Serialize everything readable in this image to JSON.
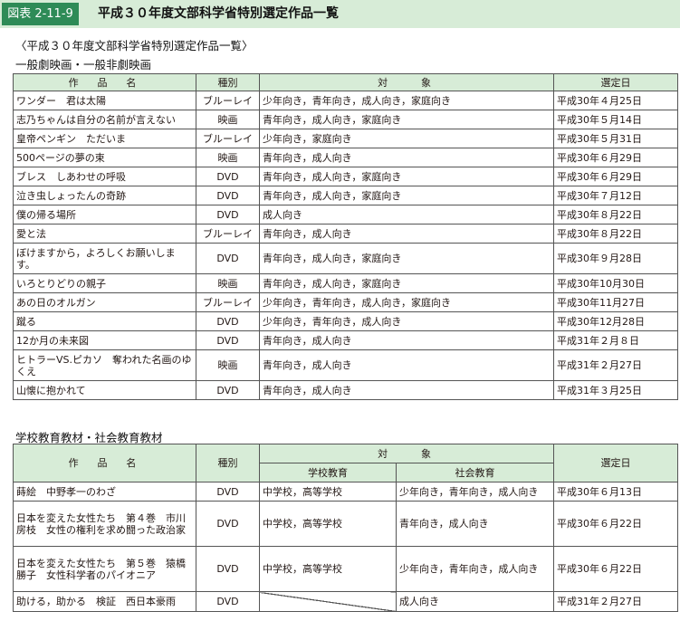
{
  "header": {
    "badge": "図表 2-11-9",
    "title": "平成３０年度文部科学省特別選定作品一覧"
  },
  "caption_main": "〈平成３０年度文部科学省特別選定作品一覧〉",
  "section1": {
    "heading": "一般劇映画・一般非劇映画",
    "columns": [
      "作　品　名",
      "種別",
      "対　　象",
      "選定日"
    ],
    "rows": [
      {
        "name": "ワンダー　君は太陽",
        "type": "ブルーレイ",
        "target": "少年向き，青年向き，成人向き，家庭向き",
        "date": "平成30年４月25日"
      },
      {
        "name": "志乃ちゃんは自分の名前が言えない",
        "type": "映画",
        "target": "青年向き，成人向き，家庭向き",
        "date": "平成30年５月14日"
      },
      {
        "name": "皇帝ペンギン　ただいま",
        "type": "ブルーレイ",
        "target": "少年向き，家庭向き",
        "date": "平成30年５月31日"
      },
      {
        "name": "500ページの夢の束",
        "type": "映画",
        "target": "青年向き，成人向き",
        "date": "平成30年６月29日"
      },
      {
        "name": "ブレス　しあわせの呼吸",
        "type": "DVD",
        "target": "青年向き，成人向き，家庭向き",
        "date": "平成30年６月29日"
      },
      {
        "name": "泣き虫しょったんの奇跡",
        "type": "DVD",
        "target": "青年向き，成人向き，家庭向き",
        "date": "平成30年７月12日"
      },
      {
        "name": "僕の帰る場所",
        "type": "DVD",
        "target": "成人向き",
        "date": "平成30年８月22日"
      },
      {
        "name": "愛と法",
        "type": "ブルーレイ",
        "target": "青年向き，成人向き",
        "date": "平成30年８月22日"
      },
      {
        "name": "ぼけますから，よろしくお願いします。",
        "type": "DVD",
        "target": "青年向き，成人向き，家庭向き",
        "date": "平成30年９月28日"
      },
      {
        "name": "いろとりどりの親子",
        "type": "映画",
        "target": "青年向き，成人向き，家庭向き",
        "date": "平成30年10月30日"
      },
      {
        "name": "あの日のオルガン",
        "type": "ブルーレイ",
        "target": "少年向き，青年向き，成人向き，家庭向き",
        "date": "平成30年11月27日"
      },
      {
        "name": "蹴る",
        "type": "DVD",
        "target": "少年向き，青年向き，成人向き",
        "date": "平成30年12月28日"
      },
      {
        "name": "12か月の未来図",
        "type": "DVD",
        "target": "青年向き，成人向き",
        "date": "平成31年２月８日"
      },
      {
        "name": "ヒトラーVS.ピカソ　奪われた名画のゆくえ",
        "type": "映画",
        "target": "青年向き，成人向き",
        "date": "平成31年２月27日"
      },
      {
        "name": "山懐に抱かれて",
        "type": "DVD",
        "target": "青年向き，成人向き",
        "date": "平成31年３月25日"
      }
    ]
  },
  "section2": {
    "heading": "学校教育教材・社会教育教材",
    "columns": {
      "name": "作　品　名",
      "type": "種別",
      "target": "対　　象",
      "school": "学校教育",
      "social": "社会教育",
      "date": "選定日"
    },
    "rows": [
      {
        "name": "蒔絵　中野孝一のわざ",
        "type": "DVD",
        "school": "中学校，高等学校",
        "social": "少年向き，青年向き，成人向き",
        "date": "平成30年６月13日"
      },
      {
        "name": "日本を変えた女性たち　第４巻　市川房枝　女性の権利を求め闘った政治家",
        "type": "DVD",
        "school": "中学校，高等学校",
        "social": "青年向き，成人向き",
        "date": "平成30年６月22日"
      },
      {
        "name": "日本を変えた女性たち　第５巻　猿橋勝子　女性科学者のパイオニア",
        "type": "DVD",
        "school": "中学校，高等学校",
        "social": "少年向き，青年向き，成人向き",
        "date": "平成30年６月22日"
      },
      {
        "name": "助ける，助かる　検証　西日本豪雨",
        "type": "DVD",
        "school": "",
        "social": "成人向き",
        "date": "平成31年２月27日"
      }
    ]
  }
}
